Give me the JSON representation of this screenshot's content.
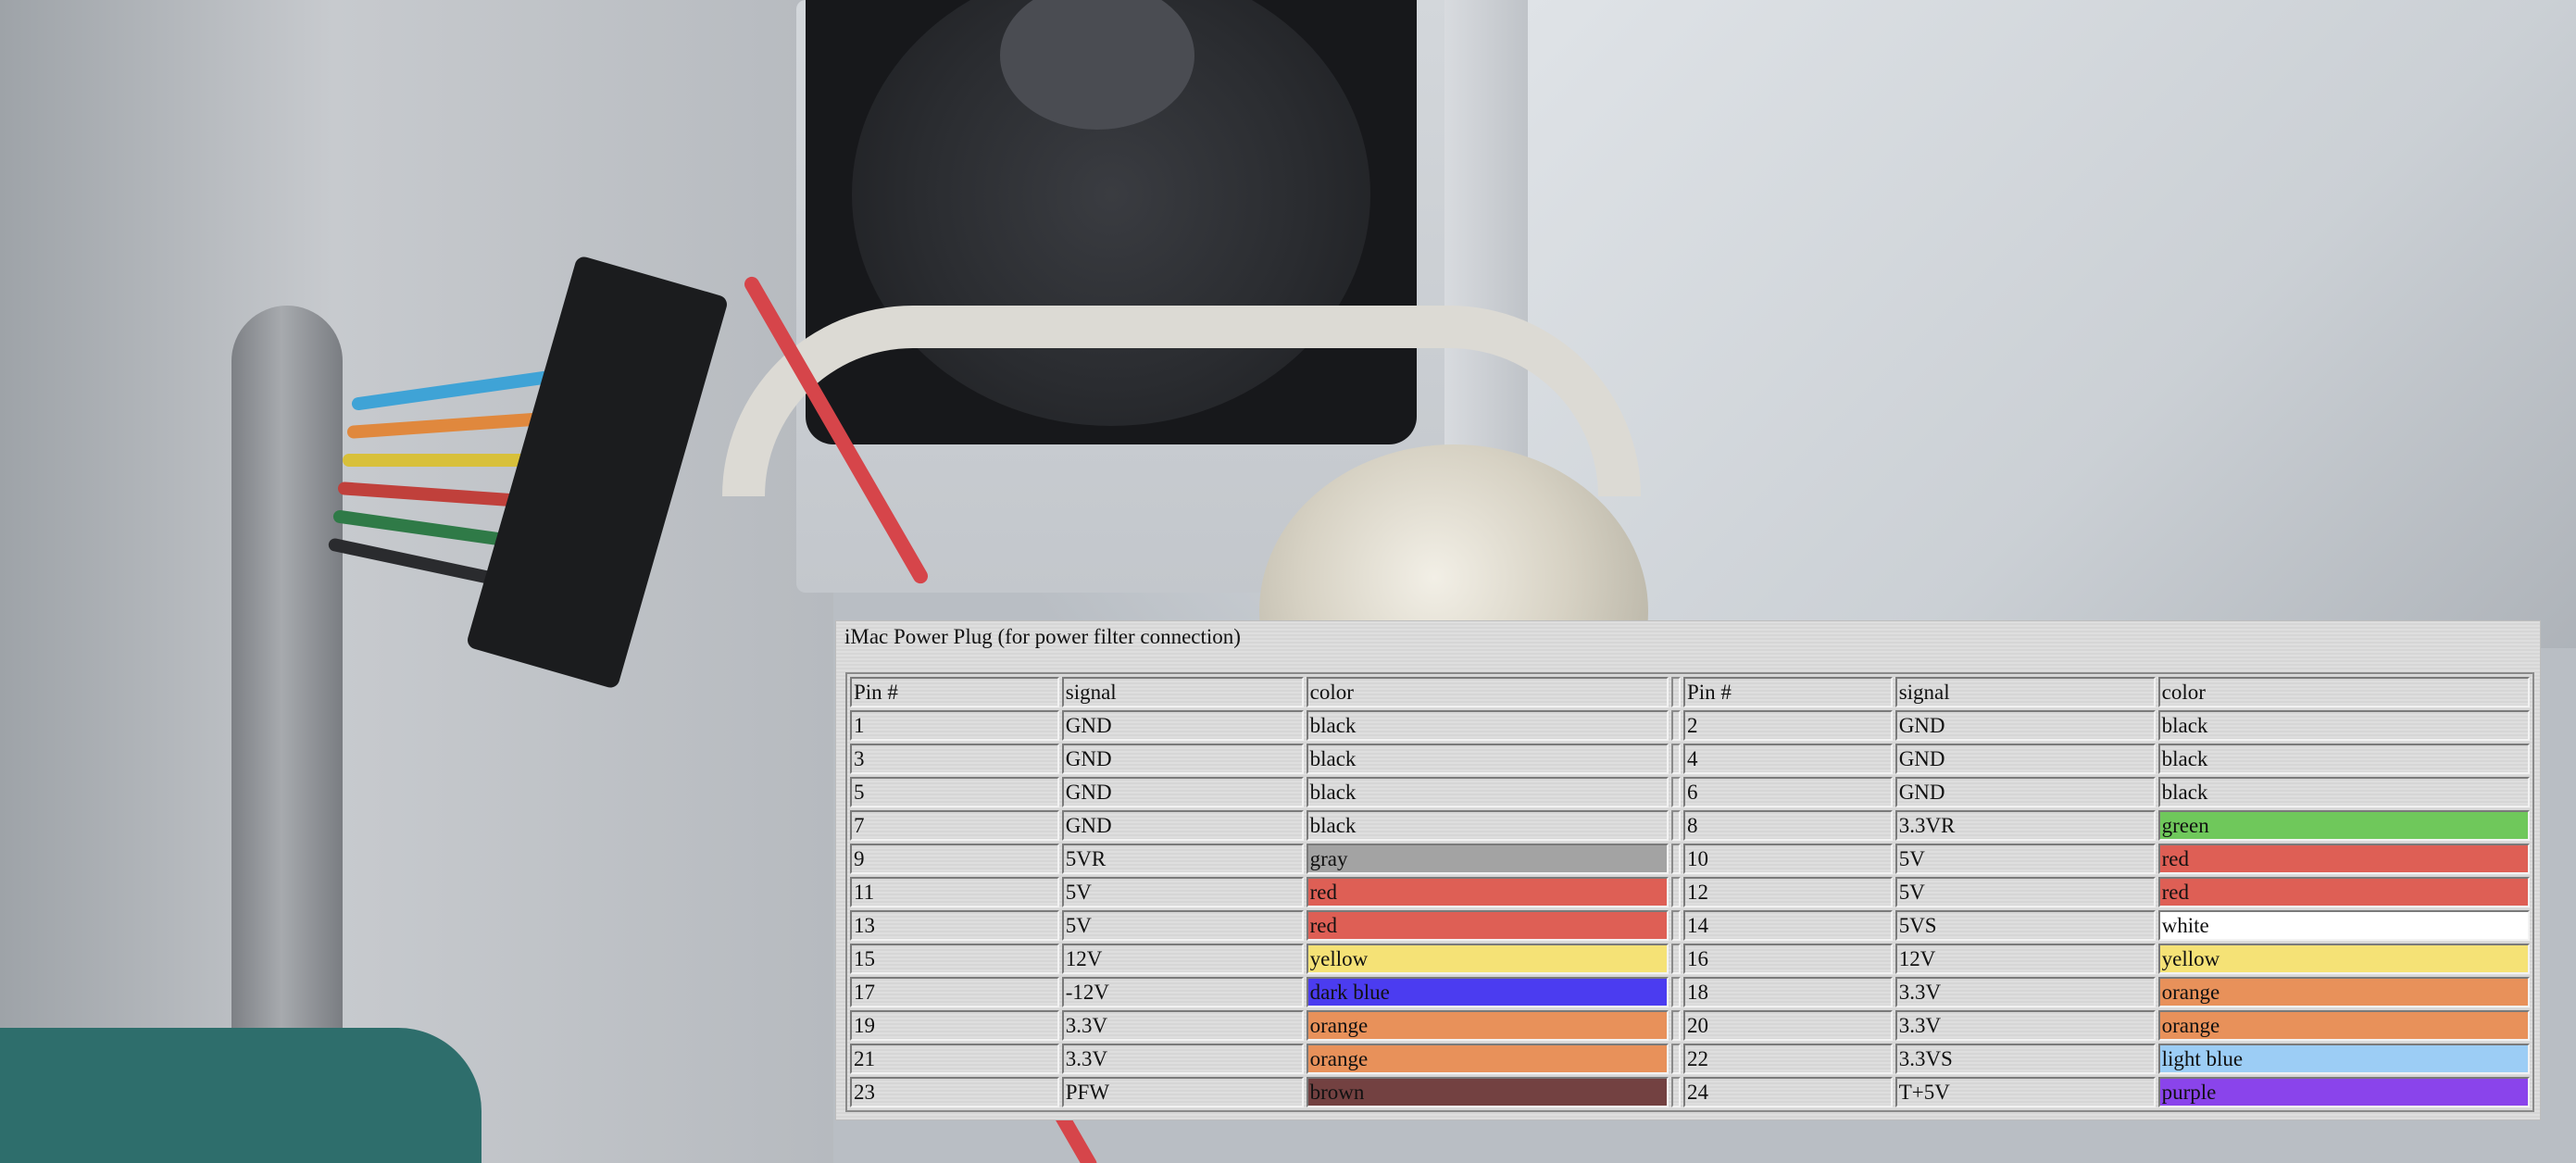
{
  "title": "iMac Power Plug (for power filter connection)",
  "headers": [
    "Pin #",
    "signal",
    "color",
    "Pin #",
    "signal",
    "color"
  ],
  "rows": [
    {
      "pin_a": "1",
      "sig_a": "GND",
      "col_a": "black",
      "hex_a": "",
      "pin_b": "2",
      "sig_b": "GND",
      "col_b": "black",
      "hex_b": ""
    },
    {
      "pin_a": "3",
      "sig_a": "GND",
      "col_a": "black",
      "hex_a": "",
      "pin_b": "4",
      "sig_b": "GND",
      "col_b": "black",
      "hex_b": ""
    },
    {
      "pin_a": "5",
      "sig_a": "GND",
      "col_a": "black",
      "hex_a": "",
      "pin_b": "6",
      "sig_b": "GND",
      "col_b": "black",
      "hex_b": ""
    },
    {
      "pin_a": "7",
      "sig_a": "GND",
      "col_a": "black",
      "hex_a": "",
      "pin_b": "8",
      "sig_b": "3.3VR",
      "col_b": "green",
      "hex_b": "#6fc85b"
    },
    {
      "pin_a": "9",
      "sig_a": "5VR",
      "col_a": "gray",
      "hex_a": "#a3a3a3",
      "pin_b": "10",
      "sig_b": "5V",
      "col_b": "red",
      "hex_b": "#de5f55"
    },
    {
      "pin_a": "11",
      "sig_a": "5V",
      "col_a": "red",
      "hex_a": "#de5f55",
      "pin_b": "12",
      "sig_b": "5V",
      "col_b": "red",
      "hex_b": "#de5f55"
    },
    {
      "pin_a": "13",
      "sig_a": "5V",
      "col_a": "red",
      "hex_a": "#de5f55",
      "pin_b": "14",
      "sig_b": "5VS",
      "col_b": "white",
      "hex_b": "#ffffff"
    },
    {
      "pin_a": "15",
      "sig_a": "12V",
      "col_a": "yellow",
      "hex_a": "#f5e276",
      "pin_b": "16",
      "sig_b": "12V",
      "col_b": "yellow",
      "hex_b": "#f5e276"
    },
    {
      "pin_a": "17",
      "sig_a": "-12V",
      "col_a": "dark blue",
      "hex_a": "#4b3cf0",
      "pin_b": "18",
      "sig_b": "3.3V",
      "col_b": "orange",
      "hex_b": "#e8915a"
    },
    {
      "pin_a": "19",
      "sig_a": "3.3V",
      "col_a": "orange",
      "hex_a": "#e8915a",
      "pin_b": "20",
      "sig_b": "3.3V",
      "col_b": "orange",
      "hex_b": "#e8915a"
    },
    {
      "pin_a": "21",
      "sig_a": "3.3V",
      "col_a": "orange",
      "hex_a": "#e8915a",
      "pin_b": "22",
      "sig_b": "3.3VS",
      "col_b": "light blue",
      "hex_b": "#9ccdf5"
    },
    {
      "pin_a": "23",
      "sig_a": "PFW",
      "col_a": "brown",
      "hex_a": "#734141",
      "pin_b": "24",
      "sig_b": "T+5V",
      "col_b": "purple",
      "hex_b": "#8a44eb"
    }
  ]
}
